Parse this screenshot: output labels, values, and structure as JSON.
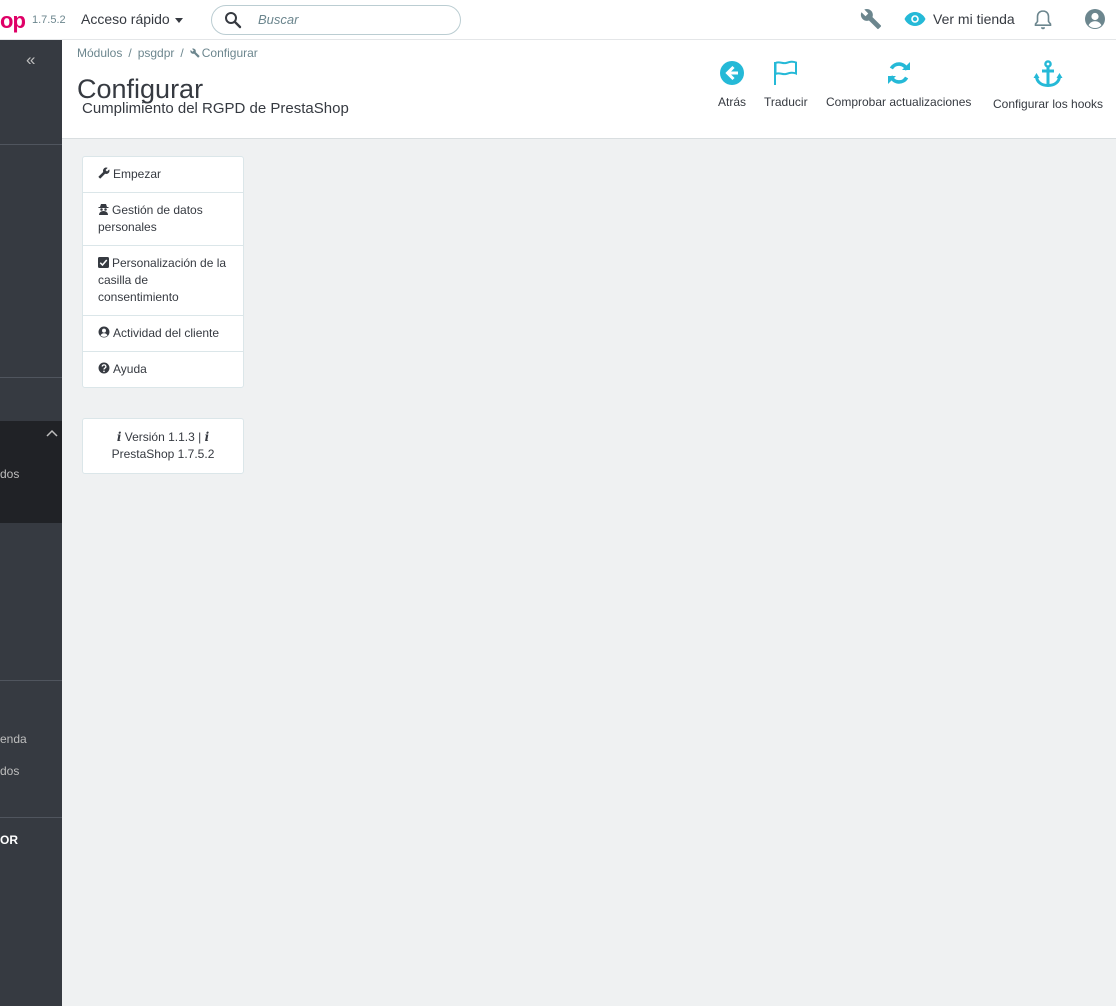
{
  "header": {
    "logo_text": "op",
    "version": "1.7.5.2",
    "quick_access": "Acceso rápido",
    "search_placeholder": "Buscar",
    "view_shop": "Ver mi tienda",
    "accent": "#df0067",
    "icon_color": "#25b9d7"
  },
  "sidebar": {
    "collapse_icon": "«",
    "partial_labels": [
      "dos",
      "enda",
      "dos",
      "OR"
    ]
  },
  "breadcrumb": [
    "Módulos",
    "psgdpr",
    "Configurar"
  ],
  "page": {
    "title": "Configurar",
    "subtitle": "Cumplimiento del RGPD de PrestaShop"
  },
  "toolbar": [
    {
      "label": "Atrás",
      "icon": "arrow-circle-left-icon"
    },
    {
      "label": "Traducir",
      "icon": "flag-icon"
    },
    {
      "label": "Comprobar actualizaciones",
      "icon": "refresh-icon"
    },
    {
      "label": "Configurar los hooks",
      "icon": "anchor-icon"
    }
  ],
  "menu": [
    {
      "label": "Empezar",
      "icon": "wrench-icon"
    },
    {
      "label": "Gestión de datos personales",
      "icon": "user-secret-icon"
    },
    {
      "label": "Personalización de la casilla de consentimiento",
      "icon": "check-square-icon"
    },
    {
      "label": "Actividad del cliente",
      "icon": "user-circle-icon"
    },
    {
      "label": "Ayuda",
      "icon": "question-circle-icon"
    }
  ],
  "version_info": {
    "line1": "Versión 1.1.3 |",
    "line2": "PrestaShop 1.7.5.2"
  }
}
